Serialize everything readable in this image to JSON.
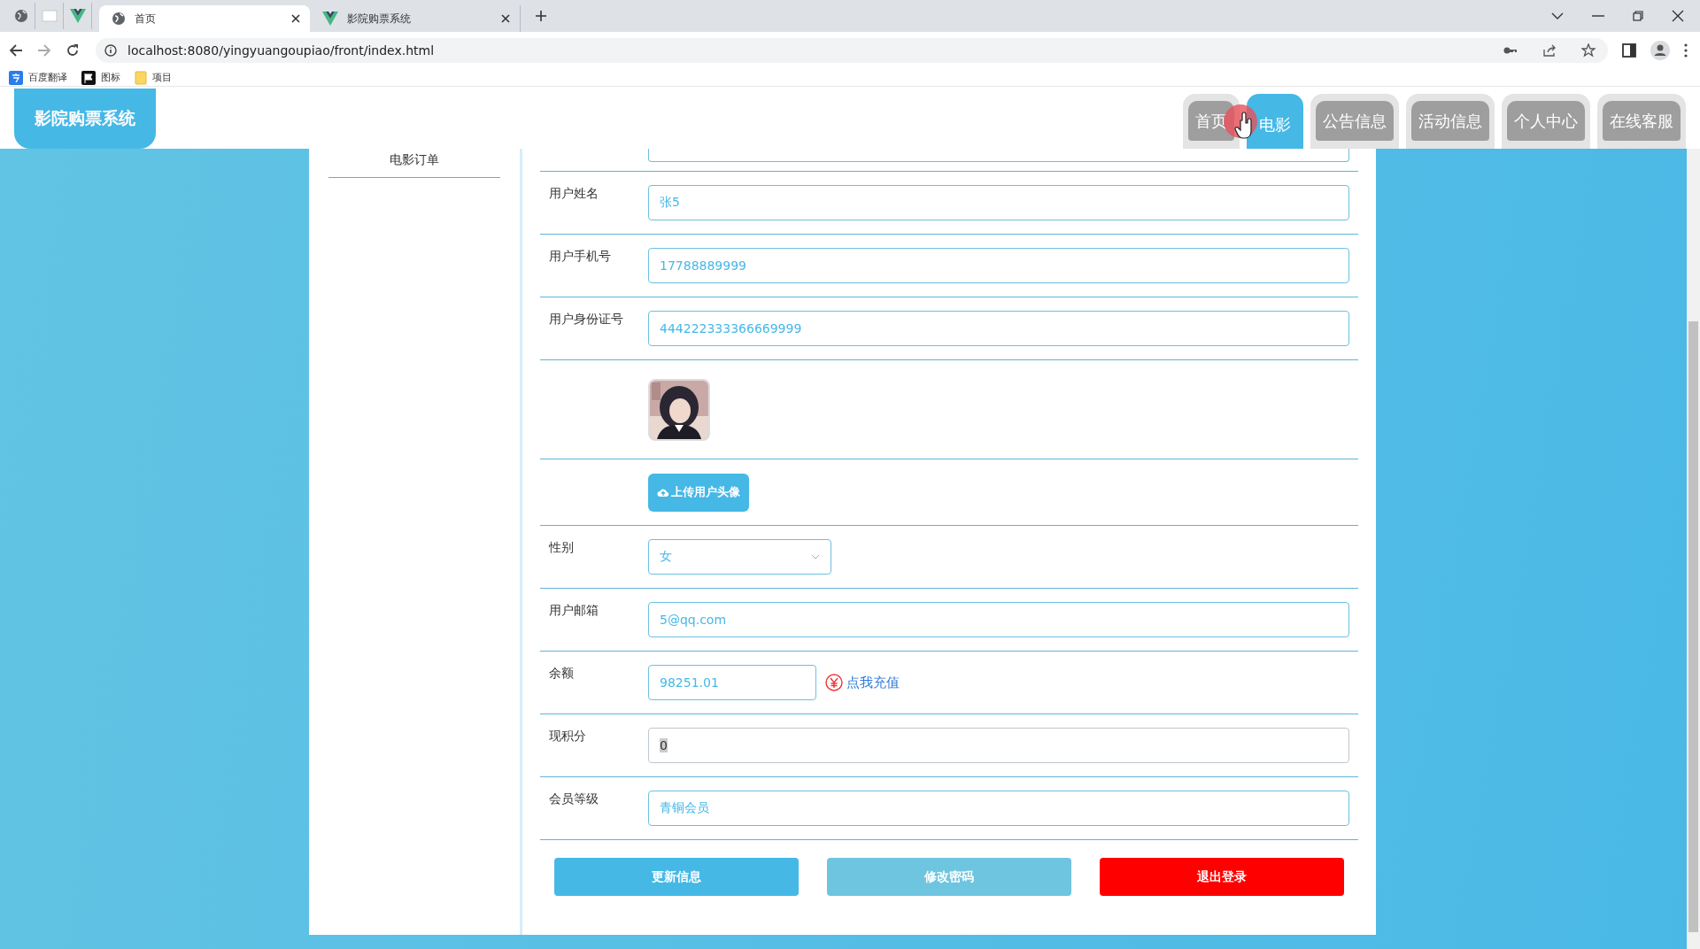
{
  "browser": {
    "tabs": [
      {
        "title": "首页",
        "selected": true
      },
      {
        "title": "影院购票系统",
        "selected": false
      }
    ],
    "address": "localhost:8080/yingyuangoupiao/front/index.html",
    "bookmarks": [
      {
        "label": "百度翻译"
      },
      {
        "label": "图标"
      },
      {
        "label": "项目"
      }
    ]
  },
  "header": {
    "logo": "影院购票系统",
    "nav": [
      {
        "label": "首页",
        "selected": false
      },
      {
        "label": "电影",
        "selected": true
      },
      {
        "label": "公告信息",
        "selected": false
      },
      {
        "label": "活动信息",
        "selected": false
      },
      {
        "label": "个人中心",
        "selected": false
      },
      {
        "label": "在线客服",
        "selected": false
      }
    ]
  },
  "sidebar": {
    "items": [
      {
        "label": "电影订单"
      }
    ]
  },
  "form": {
    "rows": [
      {
        "kind": "text",
        "label": "用户姓名",
        "value": "张5",
        "readonly": false
      },
      {
        "kind": "text",
        "label": "用户手机号",
        "value": "17788889999",
        "readonly": false
      },
      {
        "kind": "text",
        "label": "用户身份证号",
        "value": "444222333366669999",
        "readonly": false
      },
      {
        "kind": "avatar"
      },
      {
        "kind": "upload",
        "button": "上传用户头像"
      },
      {
        "kind": "select",
        "label": "性别",
        "value": "女"
      },
      {
        "kind": "text",
        "label": "用户邮箱",
        "value": "5@qq.com",
        "readonly": false
      },
      {
        "kind": "balance",
        "label": "余额",
        "value": "98251.01",
        "link": "点我充值"
      },
      {
        "kind": "text",
        "label": "现积分",
        "value": "0",
        "readonly": true
      },
      {
        "kind": "text",
        "label": "会员等级",
        "value": "青铜会员",
        "readonly": false
      }
    ],
    "actions": [
      {
        "label": "更新信息",
        "color": "#45b8e6"
      },
      {
        "label": "修改密码",
        "color": "#6ec5e0"
      },
      {
        "label": "退出登录",
        "color": "#ff0000"
      }
    ]
  }
}
